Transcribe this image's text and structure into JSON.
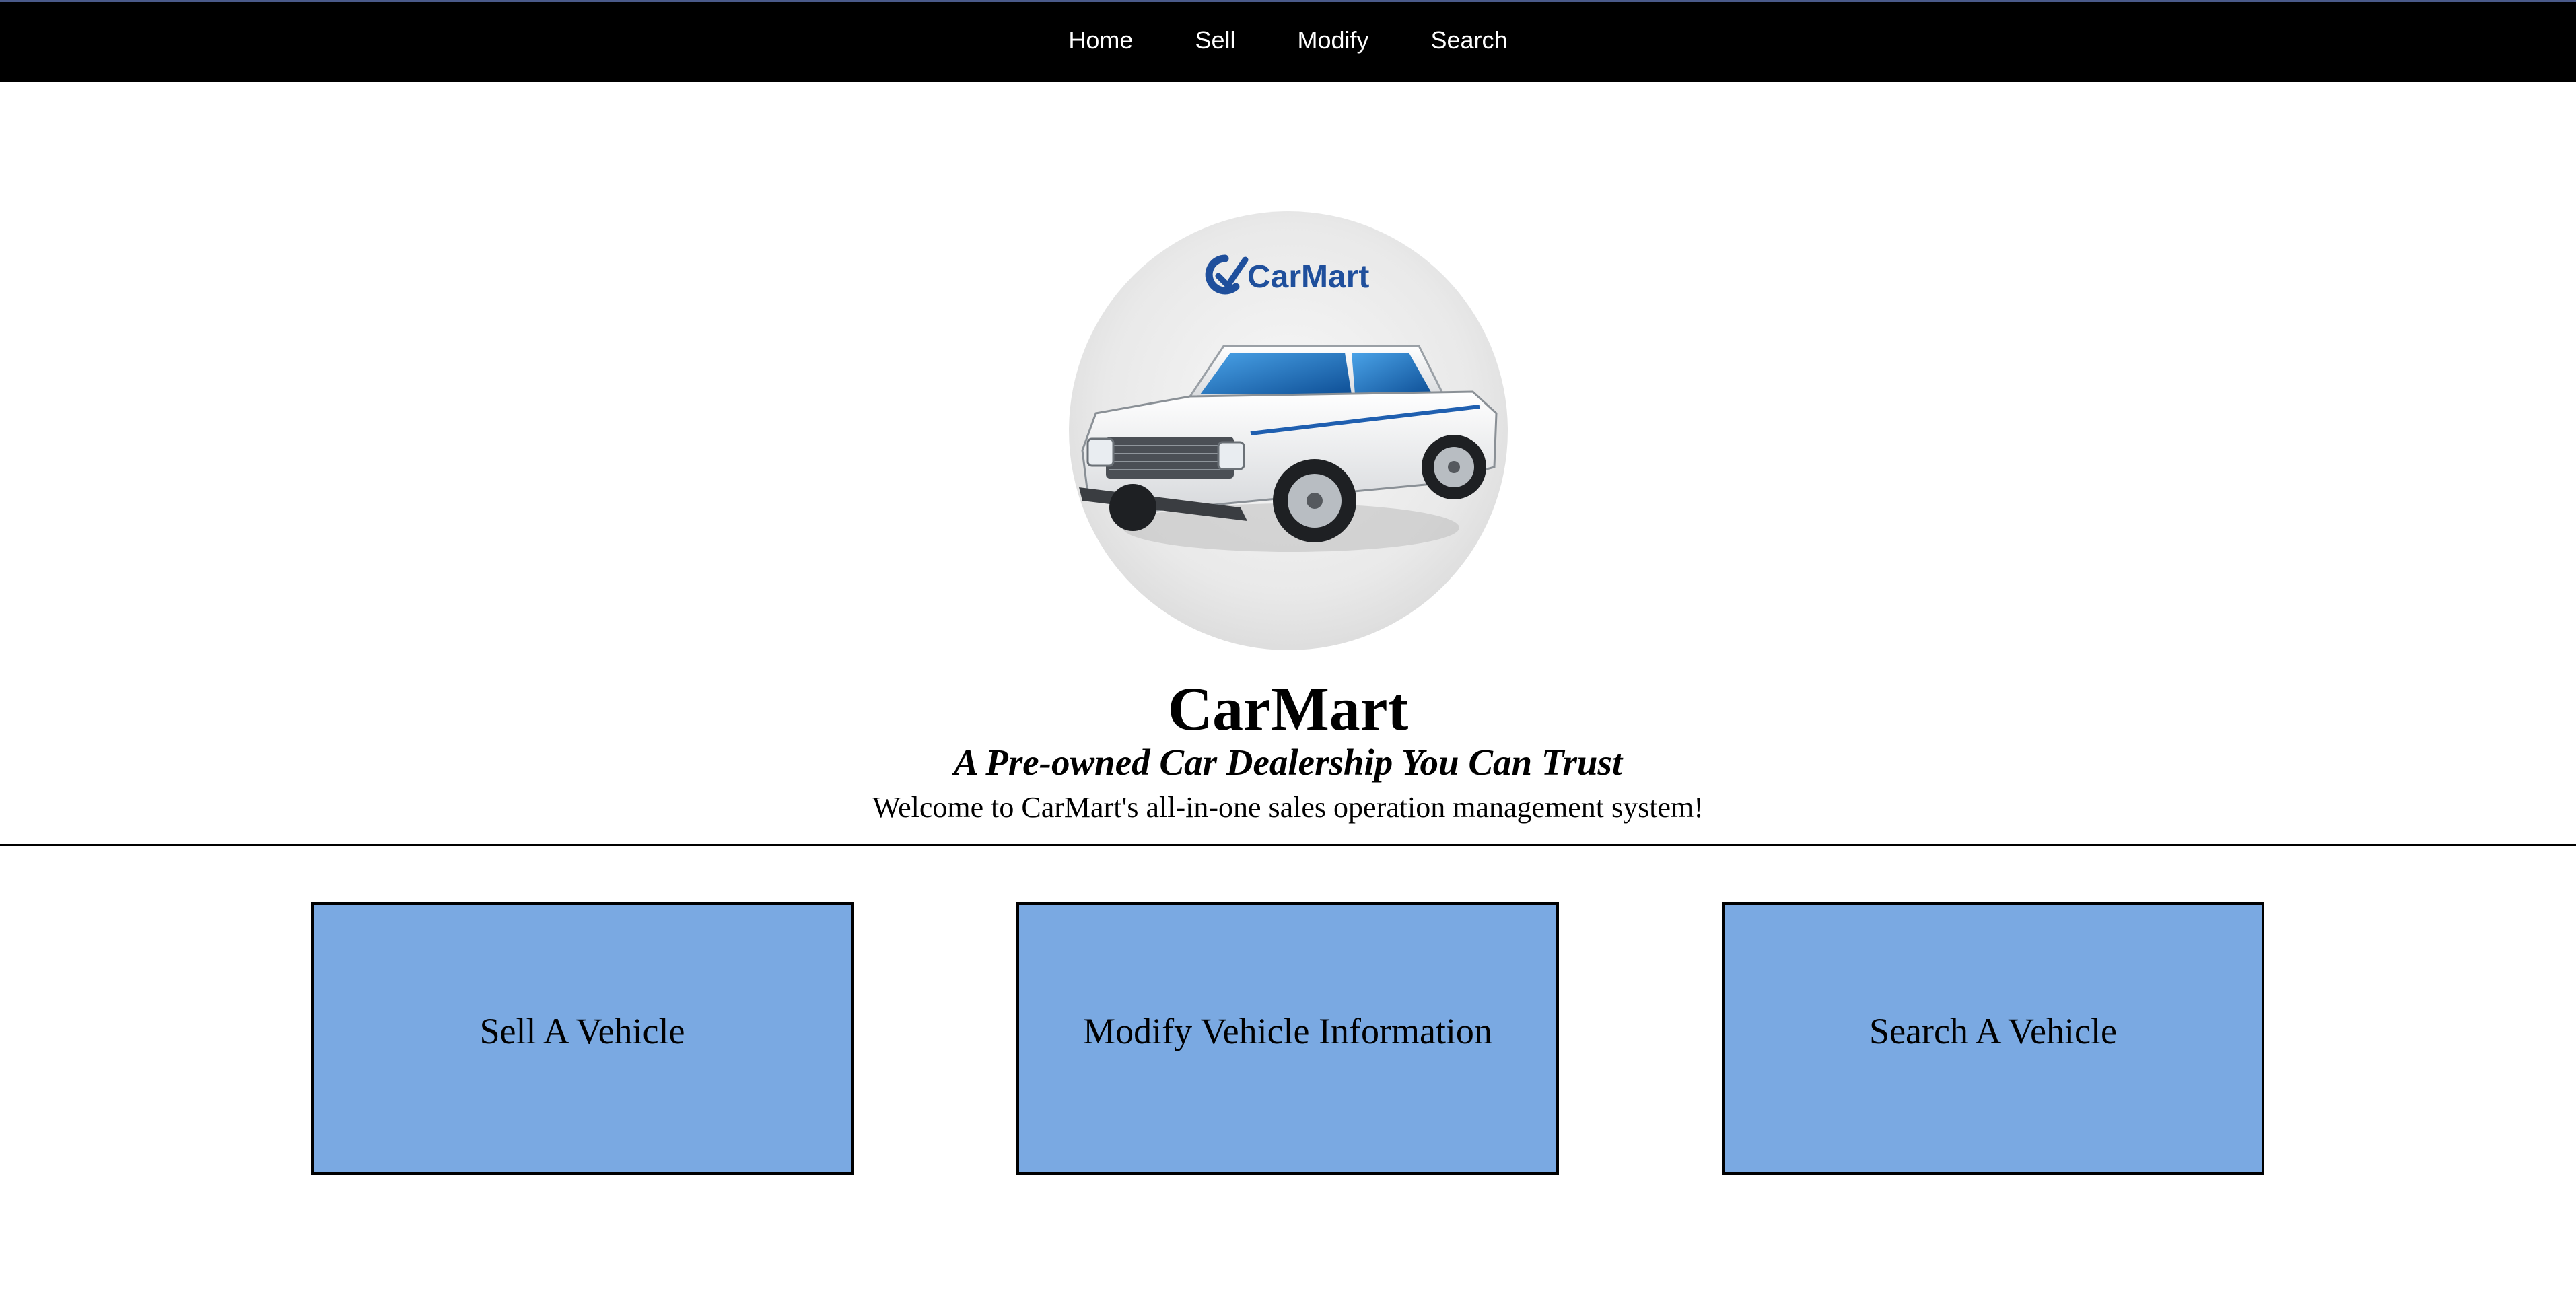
{
  "nav": {
    "items": [
      {
        "label": "Home"
      },
      {
        "label": "Sell"
      },
      {
        "label": "Modify"
      },
      {
        "label": "Search"
      }
    ]
  },
  "hero": {
    "logo_text": "CarMart",
    "logo_icon": "car-illustration",
    "title": "CarMart",
    "tagline": "A Pre-owned Car Dealership You Can Trust",
    "welcome": "Welcome to CarMart's all-in-one sales operation management system!"
  },
  "actions": [
    {
      "label": "Sell A Vehicle"
    },
    {
      "label": "Modify Vehicle Information"
    },
    {
      "label": "Search A Vehicle"
    }
  ],
  "colors": {
    "navbar_bg": "#000000",
    "nav_text": "#ffffff",
    "card_bg": "#7aa9e2",
    "logo_blue": "#1f4f9c"
  }
}
